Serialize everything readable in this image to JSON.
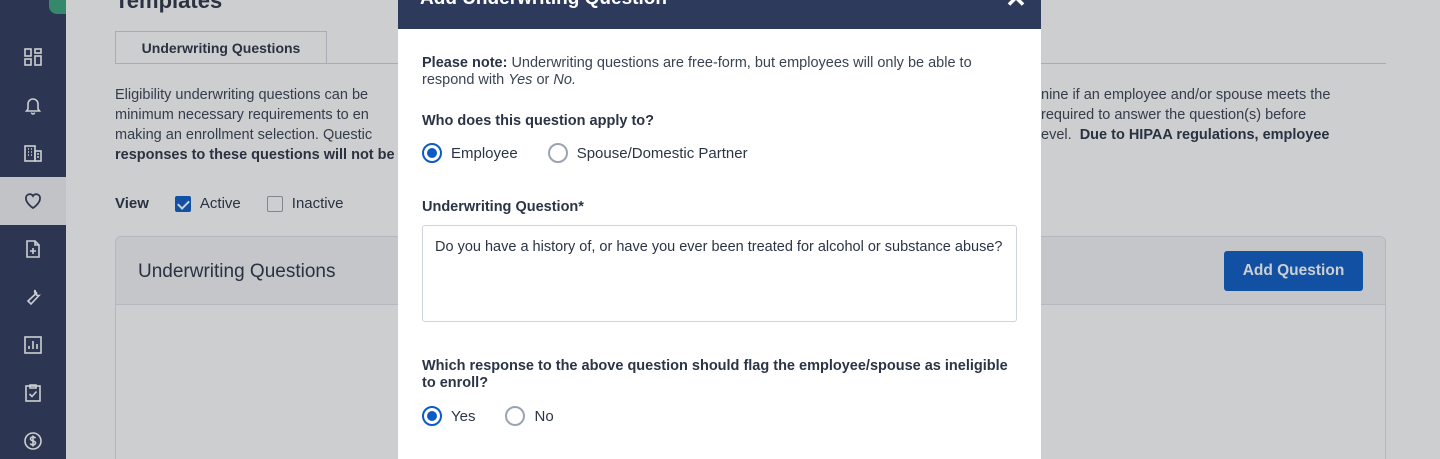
{
  "colors": {
    "sidebar": "#2e3a5c",
    "accent": "#0b5cc4",
    "brand_green": "#3aa579"
  },
  "sidebar": {
    "items": [
      {
        "icon": "dashboard-icon"
      },
      {
        "icon": "bell-icon"
      },
      {
        "icon": "building-icon"
      },
      {
        "icon": "heart-icon",
        "active": true
      },
      {
        "icon": "add-document-icon"
      },
      {
        "icon": "wrench-icon"
      },
      {
        "icon": "chart-icon"
      },
      {
        "icon": "clipboard-check-icon"
      },
      {
        "icon": "dollar-icon"
      }
    ]
  },
  "page": {
    "title": "Templates",
    "tab_label": "Underwriting Questions",
    "description_start": "Eligibility underwriting questions can be",
    "description_line2_start": "minimum necessary requirements to en",
    "description_line3_start": "making an enrollment selection. Questic",
    "description_line4_bold": "responses to these questions will not be",
    "description_right_line1": "nine if an employee and/or spouse meets the",
    "description_right_line2": "required to answer the question(s) before",
    "description_right_line3_plain": "evel.",
    "description_right_line3_bold": "Due to HIPAA regulations, employee",
    "view_label": "View",
    "filter_active": "Active",
    "filter_inactive": "Inactive",
    "card_title": "Underwriting Questions",
    "add_question_label": "Add Question"
  },
  "modal": {
    "title": "Add Underwriting Question",
    "note_bold": "Please note:",
    "note_text_1": "Underwriting questions are free-form, but employees will only be able to respond with",
    "note_yes": "Yes",
    "note_or": "or",
    "note_no": "No.",
    "applies_label": "Who does this question apply to?",
    "applies_options": [
      "Employee",
      "Spouse/Domestic Partner"
    ],
    "applies_selected": "Employee",
    "question_label": "Underwriting Question*",
    "question_value": "Do you have a history of, or have you ever been treated for alcohol or substance abuse?",
    "flag_label": "Which response to the above question should flag the employee/spouse as ineligible to enroll?",
    "flag_options": [
      "Yes",
      "No"
    ],
    "flag_selected": "Yes"
  }
}
